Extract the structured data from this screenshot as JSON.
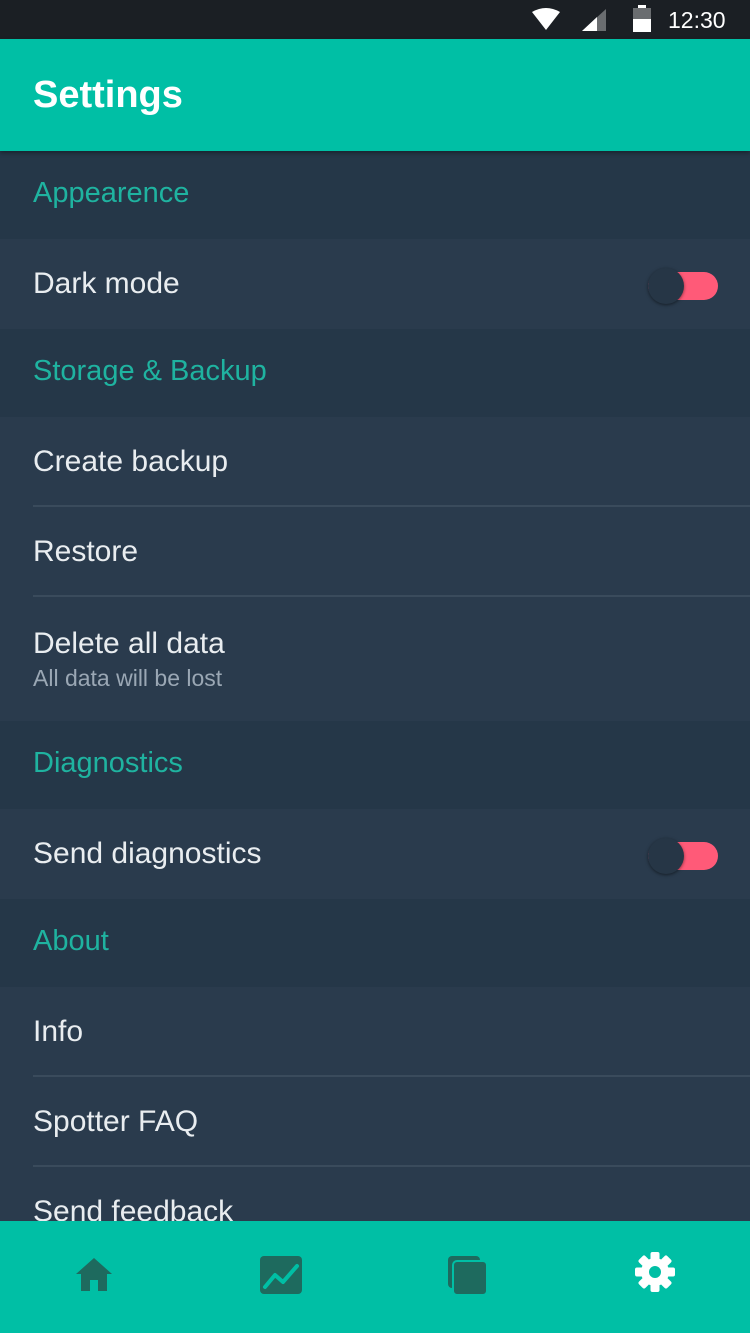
{
  "status_bar": {
    "time": "12:30",
    "icons": [
      "wifi-icon",
      "signal-icon",
      "battery-icon"
    ]
  },
  "header": {
    "title": "Settings"
  },
  "sections": [
    {
      "label": "Appearence",
      "items": [
        {
          "label": "Dark mode",
          "toggle": true
        }
      ]
    },
    {
      "label": "Storage & Backup",
      "items": [
        {
          "label": "Create backup"
        },
        {
          "label": "Restore"
        },
        {
          "label": "Delete all data",
          "sublabel": "All data will be lost"
        }
      ]
    },
    {
      "label": "Diagnostics",
      "items": [
        {
          "label": "Send diagnostics",
          "toggle": true
        }
      ]
    },
    {
      "label": "About",
      "items": [
        {
          "label": "Info"
        },
        {
          "label": "Spotter FAQ"
        },
        {
          "label": "Send feedback"
        }
      ]
    }
  ],
  "bottom_nav": {
    "items": [
      {
        "icon": "home-icon",
        "active": false
      },
      {
        "icon": "chart-icon",
        "active": false
      },
      {
        "icon": "cards-icon",
        "active": false
      },
      {
        "icon": "gear-icon",
        "active": true
      }
    ]
  },
  "colors": {
    "accent": "#00bfa5",
    "section_label": "#1fb3a0",
    "background": "#2a3b4d",
    "section_background": "#253748",
    "toggle_track": "#ff5a78",
    "status_bar": "#1b1f24",
    "nav_icon_inactive": "#1e6a5e",
    "nav_icon_active": "#ffffff"
  }
}
